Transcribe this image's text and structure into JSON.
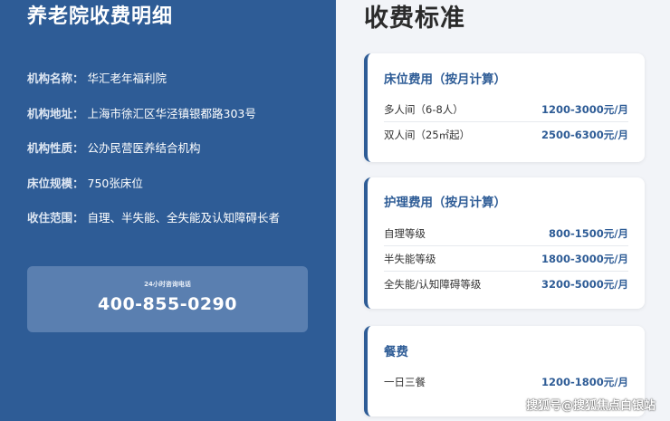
{
  "left": {
    "title": "养老院收费明细",
    "info": [
      {
        "label": "机构名称：",
        "value": "华汇老年福利院"
      },
      {
        "label": "机构地址：",
        "value": "上海市徐汇区华泾镇银都路303号"
      },
      {
        "label": "机构性质：",
        "value": "公办民营医养结合机构"
      },
      {
        "label": "床位规模：",
        "value": "750张床位"
      },
      {
        "label": "收住范围：",
        "value": "自理、半失能、全失能及认知障碍长者"
      }
    ],
    "hotline": {
      "caption": "24小时咨询电话",
      "number": "400-855-0290"
    }
  },
  "right": {
    "title": "收费标准",
    "cards": [
      {
        "title": "床位费用（按月计算）",
        "rows": [
          {
            "name": "多人间（6-8人）",
            "price": "1200-3000元/月"
          },
          {
            "name": "双人间（25㎡起）",
            "price": "2500-6300元/月"
          }
        ]
      },
      {
        "title": "护理费用（按月计算）",
        "rows": [
          {
            "name": "自理等级",
            "price": "800-1500元/月"
          },
          {
            "name": "半失能等级",
            "price": "1800-3000元/月"
          },
          {
            "name": "全失能/认知障碍等级",
            "price": "3200-5000元/月"
          }
        ]
      },
      {
        "title": "餐费",
        "rows": [
          {
            "name": "一日三餐",
            "price": "1200-1800元/月"
          }
        ]
      }
    ]
  },
  "watermark": "搜狐号@搜狐焦点白银站"
}
